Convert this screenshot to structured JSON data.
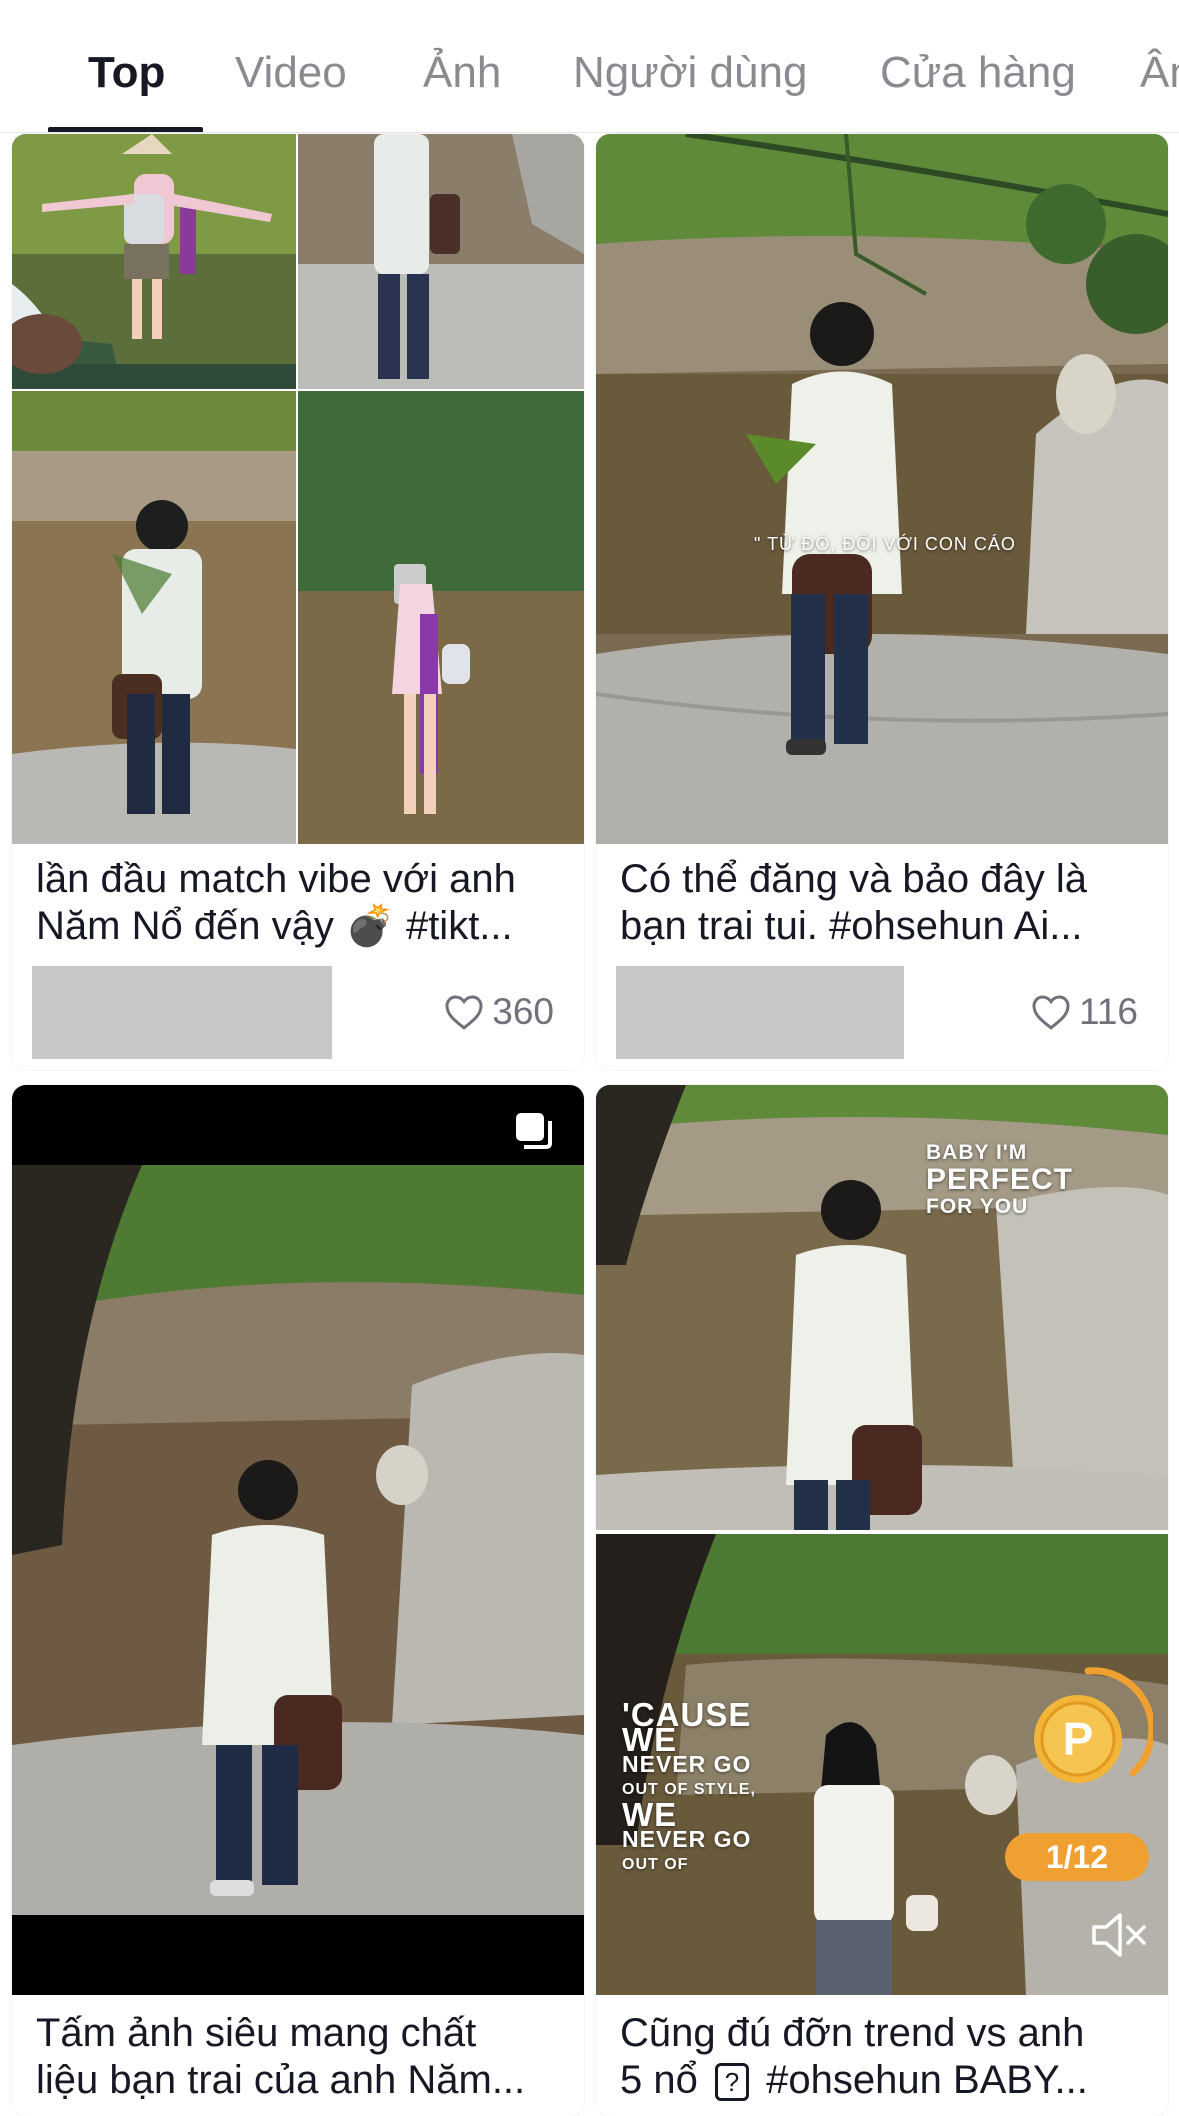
{
  "tabs": [
    {
      "label": "Top",
      "active": true
    },
    {
      "label": "Video",
      "active": false
    },
    {
      "label": "Ảnh",
      "active": false
    },
    {
      "label": "Người dùng",
      "active": false
    },
    {
      "label": "Cửa hàng",
      "active": false
    },
    {
      "label": "Âm",
      "active": false
    }
  ],
  "results": [
    {
      "caption_line1": "lần đầu match vibe với anh",
      "caption_line2": "Năm Nổ đến vậy 💣 #tikt...",
      "likes": "360"
    },
    {
      "caption_line1": "Có thể đăng và bảo đây là",
      "caption_line2": "bạn trai tui. #ohsehun  Ai...",
      "overlay_text": "\" TỪ ĐÓ, ĐỐI VỚI CON CÁO",
      "likes": "116"
    },
    {
      "caption_line1": "Tấm ảnh siêu mang chất",
      "caption_line2": "liệu bạn trai của anh Năm..."
    },
    {
      "caption_line1": "Cũng đú đỡn trend vs anh",
      "caption_line2": "5 nổ",
      "caption_line2_end": "#ohsehun BABY...",
      "overlay_top_1": "BABY I'M",
      "overlay_top_2": "PERFECT",
      "overlay_top_3": "FOR YOU",
      "overlay_bottom": [
        "'CAUSE",
        "WE",
        "NEVER GO",
        "OUT OF STYLE,",
        "WE",
        "NEVER GO",
        "OUT OF"
      ],
      "coin_label": "P",
      "slide_counter": "1/12"
    }
  ],
  "colors": {
    "text_primary": "#161823",
    "text_secondary": "#8a8b91",
    "coin_orange": "#f0a030",
    "placeholder_gray": "#c8c8c8"
  },
  "icons": [
    "heart-icon",
    "carousel-icon",
    "mute-icon",
    "coin-icon",
    "question-box-icon"
  ]
}
